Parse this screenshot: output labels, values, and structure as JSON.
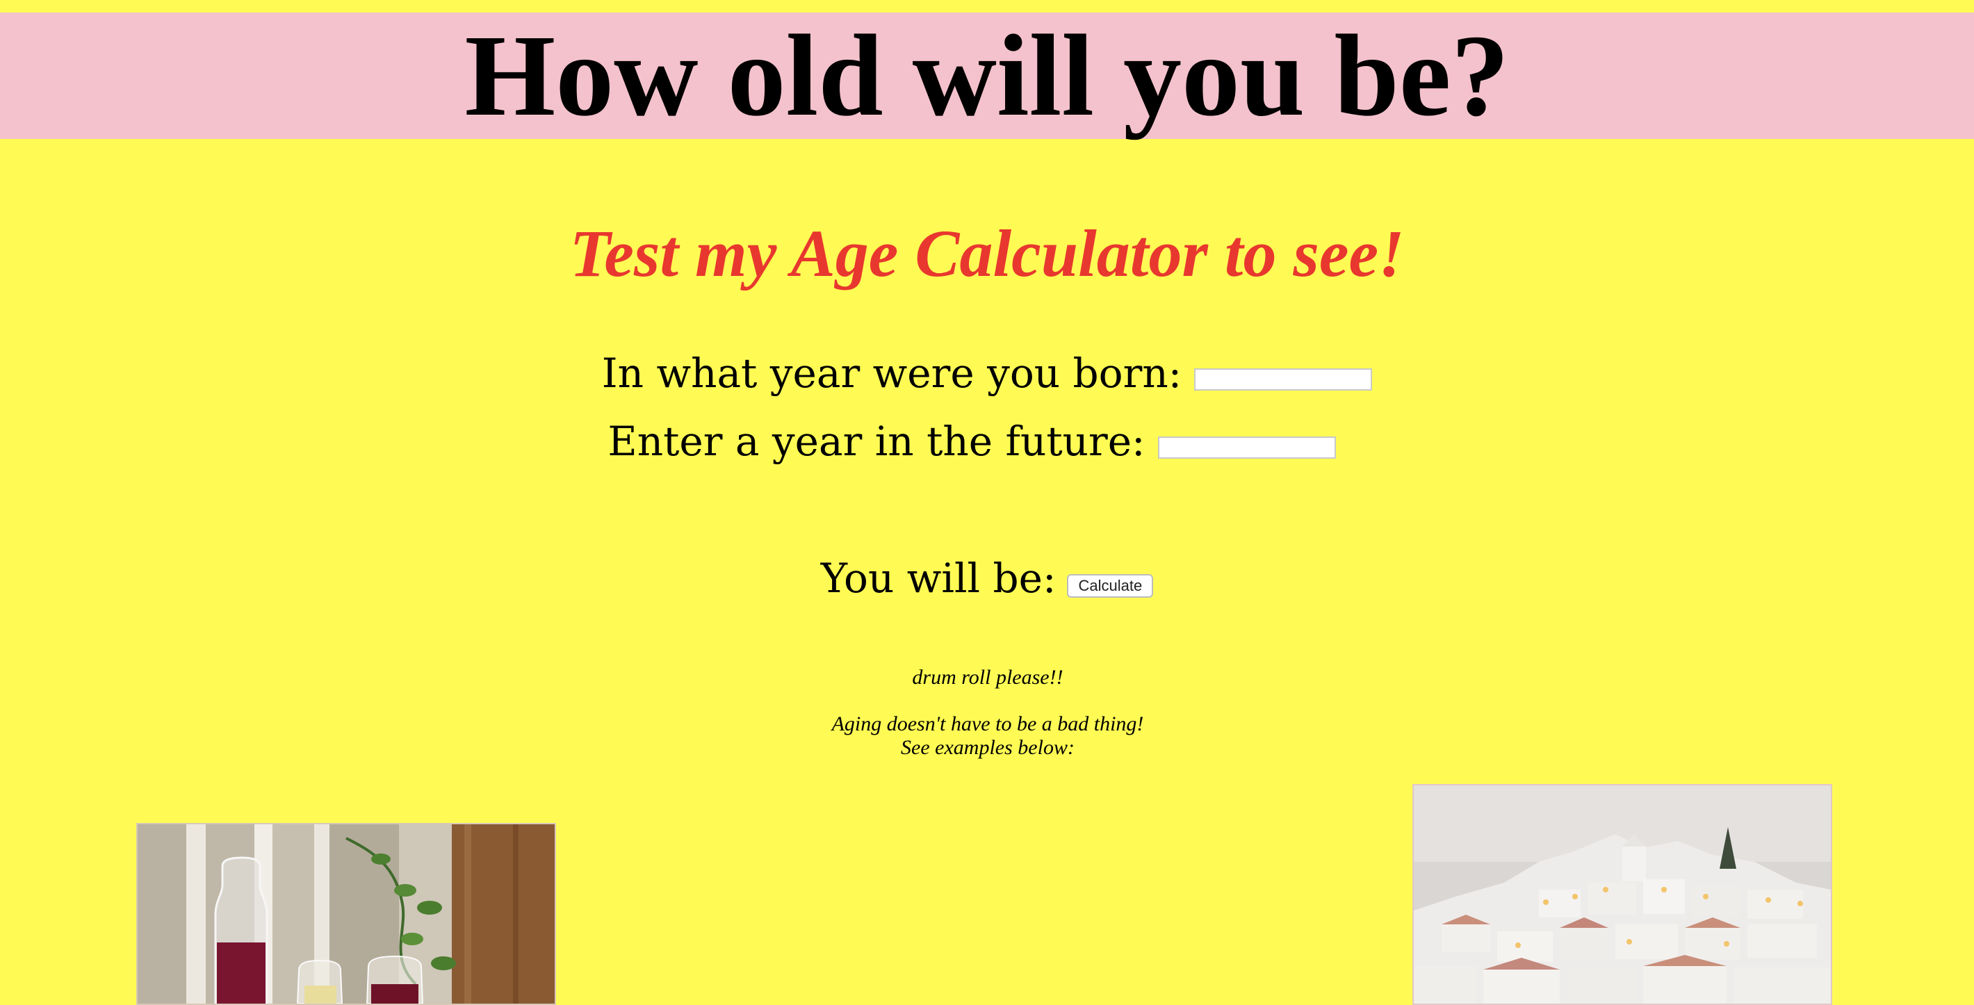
{
  "page": {
    "title": "How old will you be?",
    "subtitle": "Test my Age Calculator to see!",
    "colors": {
      "background": "#fffb54",
      "header_band": "#f4c2cc",
      "subtitle": "#e8372f"
    }
  },
  "form": {
    "born_label": "In what year were you born:",
    "born_value": "",
    "future_label": "Enter a year in the future:",
    "future_value": "",
    "result_label": "You will be:",
    "calculate_button": "Calculate"
  },
  "messages": {
    "drum_roll": "drum roll please!!",
    "aging": "Aging doesn't have to be a bad thing!",
    "examples": "See examples below:"
  },
  "images": {
    "left": "wine-carafe-and-glasses-photo",
    "right": "hillside-white-town-photo"
  }
}
